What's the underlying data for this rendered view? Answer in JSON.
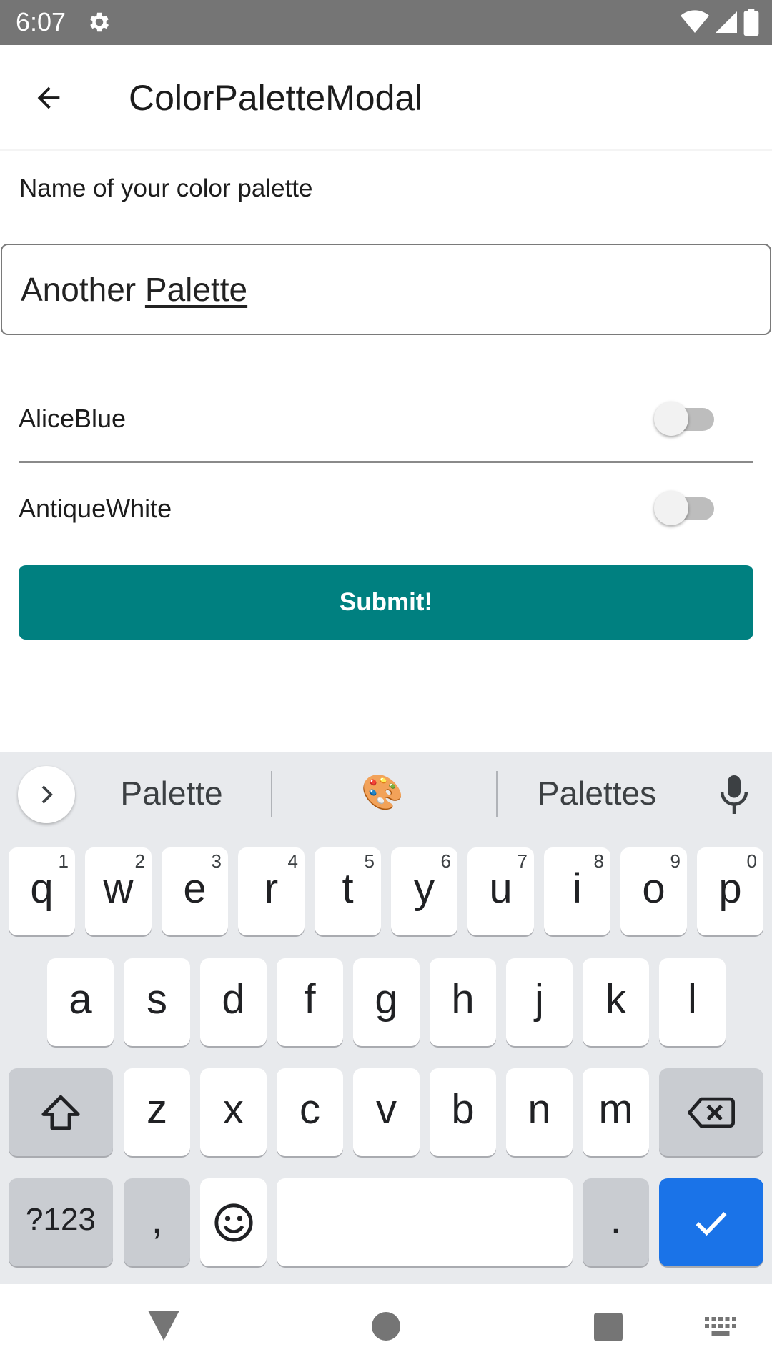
{
  "status_bar": {
    "time": "6:07",
    "icons": [
      "settings-gear-icon",
      "wifi-icon",
      "cell-signal-icon",
      "battery-icon"
    ]
  },
  "app_bar": {
    "title": "ColorPaletteModal",
    "back_icon": "arrow-back-icon"
  },
  "form": {
    "name_label": "Name of your color palette",
    "name_value_word1": "Another",
    "name_value_word2": "Palette",
    "colors": [
      {
        "label": "AliceBlue",
        "checked": false
      },
      {
        "label": "AntiqueWhite",
        "checked": false
      }
    ],
    "submit_label": "Submit!"
  },
  "keyboard": {
    "suggestions": [
      "Palette",
      "🎨",
      "Palettes"
    ],
    "row1": [
      {
        "key": "q",
        "hint": "1"
      },
      {
        "key": "w",
        "hint": "2"
      },
      {
        "key": "e",
        "hint": "3"
      },
      {
        "key": "r",
        "hint": "4"
      },
      {
        "key": "t",
        "hint": "5"
      },
      {
        "key": "y",
        "hint": "6"
      },
      {
        "key": "u",
        "hint": "7"
      },
      {
        "key": "i",
        "hint": "8"
      },
      {
        "key": "o",
        "hint": "9"
      },
      {
        "key": "p",
        "hint": "0"
      }
    ],
    "row2": [
      "a",
      "s",
      "d",
      "f",
      "g",
      "h",
      "j",
      "k",
      "l"
    ],
    "row3": [
      "z",
      "x",
      "c",
      "v",
      "b",
      "n",
      "m"
    ],
    "symbols_label": "?123",
    "comma_label": ",",
    "period_label": "."
  },
  "colors": {
    "status_bar": "#757575",
    "accent_teal": "#008080",
    "keyboard_bg": "#e8eaed",
    "enter_key_blue": "#1a73e8"
  }
}
